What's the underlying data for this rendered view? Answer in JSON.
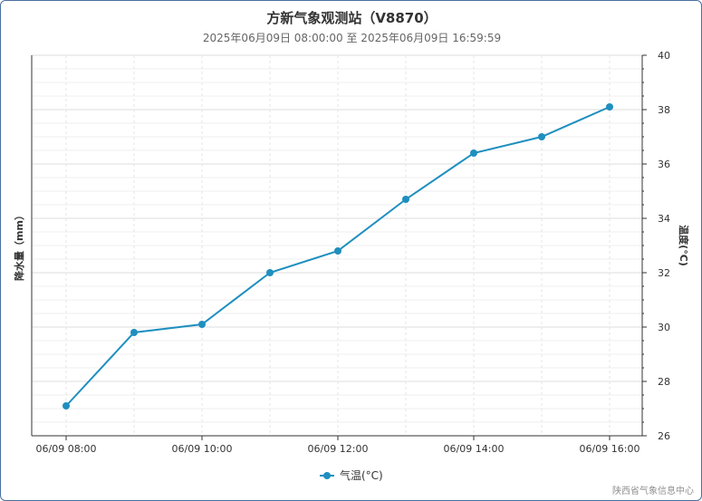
{
  "title": "方新气象观测站（V8870）",
  "subtitle": "2025年06月09日 08:00:00 至 2025年06月09日 16:59:59",
  "credit": "陕西省气象信息中心",
  "colors": {
    "series": "#1f8fbf",
    "grid": "#e6e6e6",
    "axis": "#333333",
    "frame": "#4a6fa0"
  },
  "chart_data": {
    "type": "line",
    "title": "方新气象观测站（V8870）",
    "subtitle": "2025年06月09日 08:00:00 至 2025年06月09日 16:59:59",
    "y_left_label": "降水量（mm）",
    "y_right_label": "温度(°C)",
    "x_tick_labels": [
      "06/09 08:00",
      "06/09 10:00",
      "06/09 12:00",
      "06/09 14:00",
      "06/09 16:00"
    ],
    "y_right_ticks": [
      "40",
      "38",
      "36",
      "34",
      "32",
      "30",
      "28",
      "26"
    ],
    "y_right_range": [
      26,
      40
    ],
    "grid": true,
    "legend_position": "bottom-center",
    "series": [
      {
        "name": "气温(°C)",
        "x": [
          "06/09 08:00",
          "06/09 09:00",
          "06/09 10:00",
          "06/09 11:00",
          "06/09 12:00",
          "06/09 13:00",
          "06/09 14:00",
          "06/09 15:00",
          "06/09 16:00"
        ],
        "values": [
          27.1,
          29.8,
          30.1,
          32.0,
          32.8,
          34.7,
          36.4,
          37.0,
          38.1
        ]
      }
    ]
  }
}
